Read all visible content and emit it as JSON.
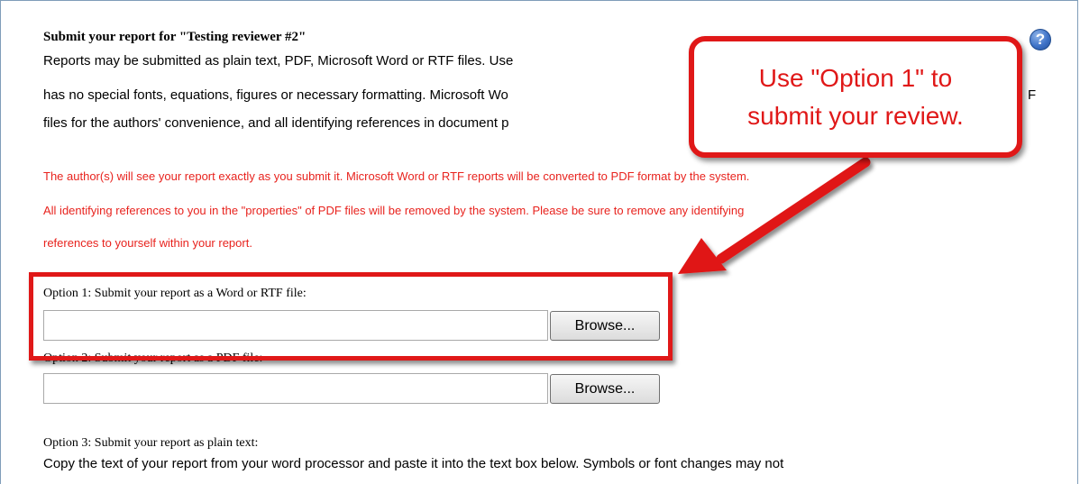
{
  "header": {
    "title": "Submit your report for \"Testing reviewer #2\"",
    "help_icon": "question-mark-icon"
  },
  "intro": {
    "line1": "Reports may be submitted as plain text, PDF, Microsoft Word or RTF files. Use",
    "line2": "has no special fonts, equations, figures or necessary formatting. Microsoft Wo",
    "line2_tail": "F",
    "line3": "files for the authors' convenience, and all identifying references in document p"
  },
  "warning": {
    "line1": "The author(s) will see your report exactly as you submit it. Microsoft Word or RTF reports will be converted to PDF format by the system.",
    "line2": "All identifying references to you in the \"properties\" of PDF files will be removed by the system. Please be sure to remove any identifying",
    "line3": "references to yourself within your report."
  },
  "option1": {
    "label": "Option 1: Submit your report as a Word or RTF file:",
    "file_value": "",
    "browse_label": "Browse..."
  },
  "option2": {
    "label": "Option 2: Submit your report as a PDF file:",
    "file_value": "",
    "browse_label": "Browse..."
  },
  "option3": {
    "label": "Option 3: Submit your report as plain text:",
    "description": "Copy the text of your report from your word processor and paste it into the text box below. Symbols or font changes may not"
  },
  "callout": {
    "line1": "Use \"Option 1\" to",
    "line2": "submit your review."
  },
  "colors": {
    "accent_red": "#e01818",
    "warning_red": "#e8231e"
  }
}
